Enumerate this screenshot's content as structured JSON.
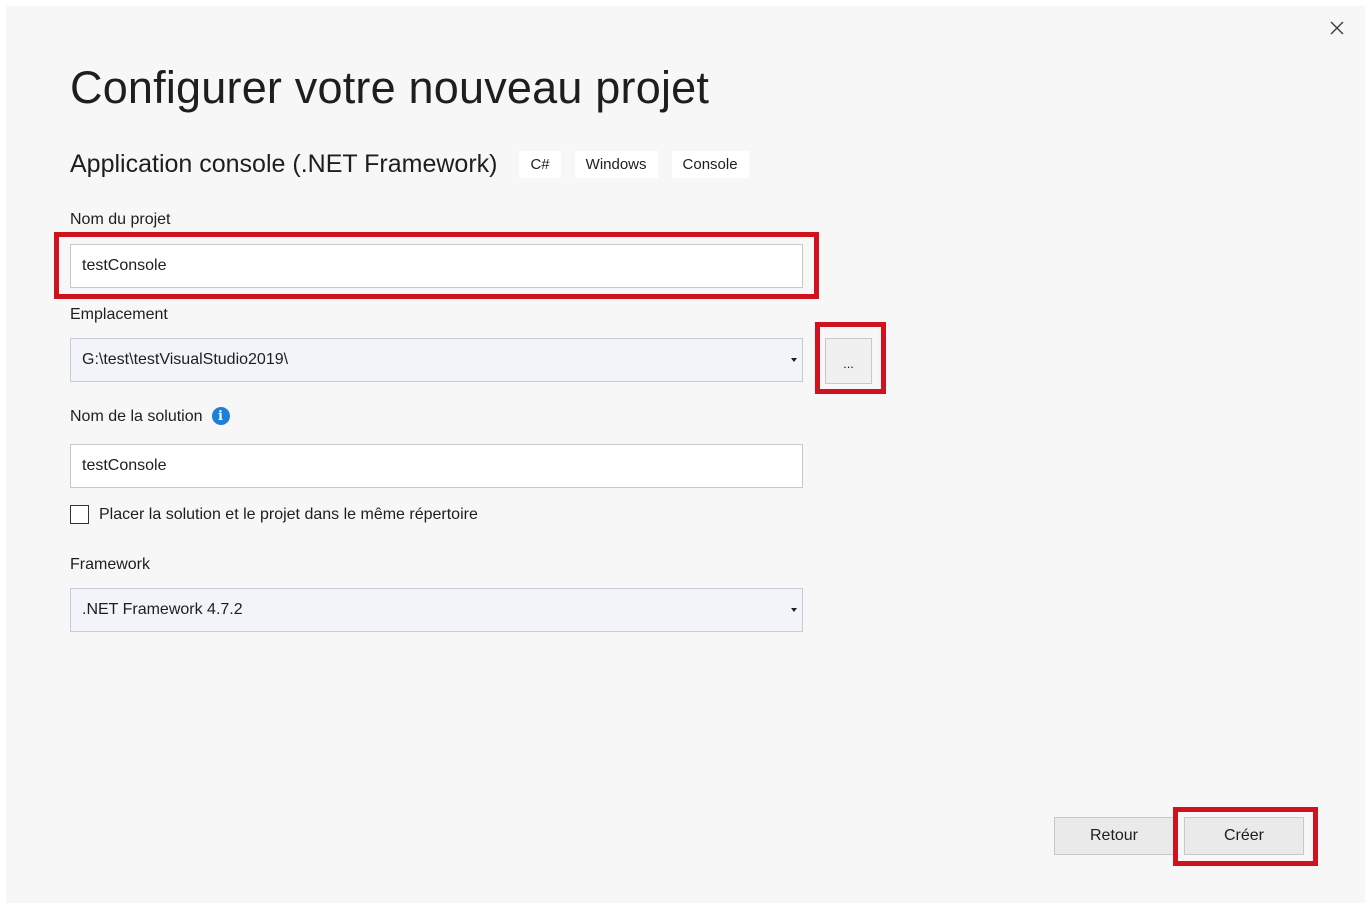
{
  "dialog": {
    "title": "Configurer votre nouveau projet",
    "close_icon": "close-icon"
  },
  "template": {
    "name": "Application console (.NET Framework)",
    "tags": [
      "C#",
      "Windows",
      "Console"
    ]
  },
  "project_name": {
    "label": "Nom du projet",
    "value": "testConsole"
  },
  "location": {
    "label": "Emplacement",
    "value": "G:\\test\\testVisualStudio2019\\",
    "browse_label": "..."
  },
  "solution_name": {
    "label": "Nom de la solution",
    "info_icon": "info-icon",
    "value": "testConsole"
  },
  "same_directory": {
    "label": "Placer la solution et le projet dans le même répertoire",
    "checked": false
  },
  "framework": {
    "label": "Framework",
    "value": ".NET Framework 4.7.2"
  },
  "footer": {
    "back_label": "Retour",
    "create_label": "Créer"
  },
  "colors": {
    "highlight": "#d0121e",
    "info_blue": "#1e7fd8",
    "background": "#f7f7f7"
  }
}
